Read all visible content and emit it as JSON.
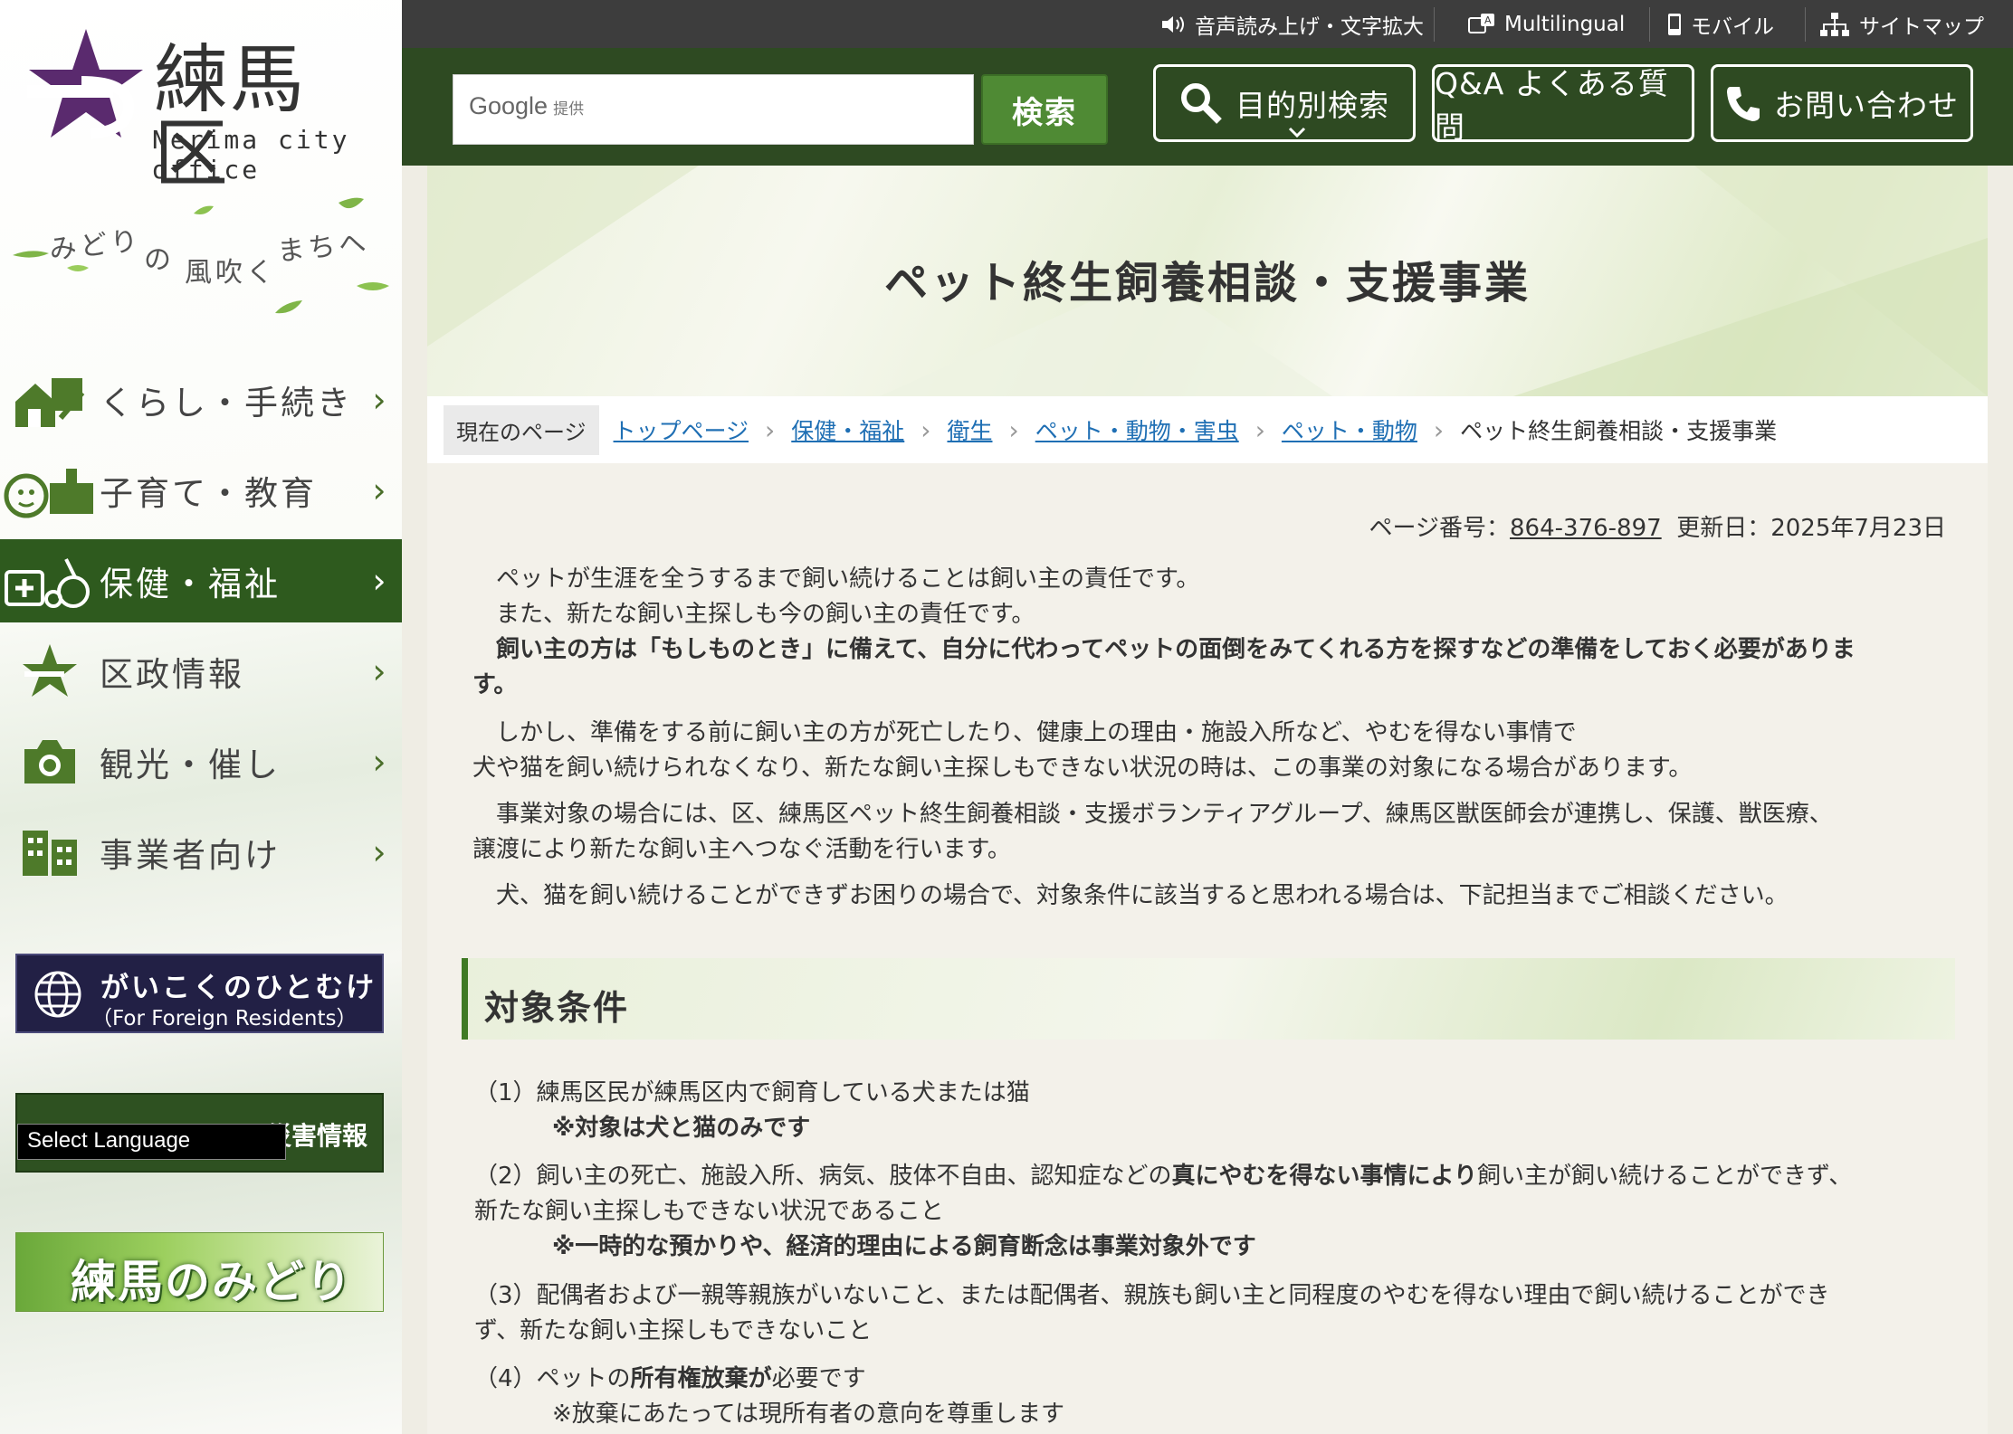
{
  "colors": {
    "header_green": "#2e4a22",
    "active_nav": "#2e5a1e",
    "accent_purple": "#5a2a6e",
    "link": "#1f6fb4"
  },
  "logo": {
    "title": "練馬区",
    "subtitle": "Nerima city office"
  },
  "tagline": {
    "part1": "みどり",
    "part2": "の",
    "part3": "風吹く",
    "part4": "まちへ"
  },
  "nav": [
    {
      "label": "くらし・手続き",
      "icon": "house-pen-icon"
    },
    {
      "label": "子育て・教育",
      "icon": "child-school-icon"
    },
    {
      "label": "保健・福祉",
      "icon": "medical-wheelchair-icon"
    },
    {
      "label": "区政情報",
      "icon": "nerima-emblem-icon"
    },
    {
      "label": "観光・催し",
      "icon": "camera-icon"
    },
    {
      "label": "事業者向け",
      "icon": "building-icon"
    }
  ],
  "banners": {
    "foreign_line1": "がいこくのひとむけ",
    "foreign_line2": "（For Foreign Residents）",
    "disaster_text": "災害情報",
    "language_select": "Select Language",
    "midori_text": "練馬のみどり"
  },
  "utility": {
    "voice": "音声読み上げ・文字拡大",
    "multilingual": "Multilingual",
    "mobile": "モバイル",
    "sitemap": "サイトマップ"
  },
  "header": {
    "search_label": "Google",
    "search_provided": "提供",
    "search_button": "検索",
    "purpose_search": "目的別検索",
    "faq": "Q&A よくある質問",
    "contact": "お問い合わせ"
  },
  "page": {
    "title": "ペット終生飼養相談・支援事業",
    "breadcrumb_here": "現在のページ",
    "breadcrumb": [
      "トップページ",
      "保健・福祉",
      "衛生",
      "ペット・動物・害虫",
      "ペット・動物"
    ],
    "breadcrumb_current": "ペット終生飼養相談・支援事業",
    "page_number_label": "ページ番号：",
    "page_number": "864-376-897",
    "updated": "更新日：2025年7月23日"
  },
  "body": {
    "p1_1": "　ペットが生涯を全うするまで飼い続けることは飼い主の責任です。",
    "p1_2": "　また、新たな飼い主探しも今の飼い主の責任です。",
    "p1_3a": "　飼い主の方は「もしものとき」に備えて、自分に代わってペットの面倒をみてくれる方を探すなどの準備をしておく必要がありま",
    "p1_3b": "す。",
    "p2_1": "　しかし、準備をする前に飼い主の方が死亡したり、健康上の理由・施設入所など、やむを得ない事情で",
    "p2_2": "犬や猫を飼い続けられなくなり、新たな飼い主探しもできない状況の時は、この事業の対象になる場合があります。",
    "p3_1": "　事業対象の場合には、区、練馬区ペット終生飼養相談・支援ボランティアグループ、練馬区獣医師会が連携し、保護、獣医療、",
    "p3_2": "譲渡により新たな飼い主へつなぐ活動を行います。",
    "p4": "　犬、猫を飼い続けることができずお困りの場合で、対象条件に該当すると思われる場合は、下記担当までご相談ください。",
    "heading": "対象条件",
    "c1": "（1）練馬区民が練馬区内で飼育している犬または猫",
    "c1_note": "※対象は犬と猫のみです",
    "c2_a": "（2）飼い主の死亡、施設入所、病気、肢体不自由、認知症などの",
    "c2_b": "真にやむを得ない事情により",
    "c2_c": "飼い主が飼い続けることができず、",
    "c2_d": "新たな飼い主探しもできない状況であること",
    "c2_note": "※一時的な預かりや、経済的理由による飼育断念は事業対象外です",
    "c3_a": "（3）配偶者および一親等親族がいないこと、または配偶者、親族も飼い主と同程度のやむを得ない理由で飼い続けることができ",
    "c3_b": "ず、新たな飼い主探しもできないこと",
    "c4_a": "（4）ペットの",
    "c4_b": "所有権放棄が",
    "c4_c": "必要です",
    "c4_note": "※放棄にあたっては現所有者の意向を尊重します"
  }
}
